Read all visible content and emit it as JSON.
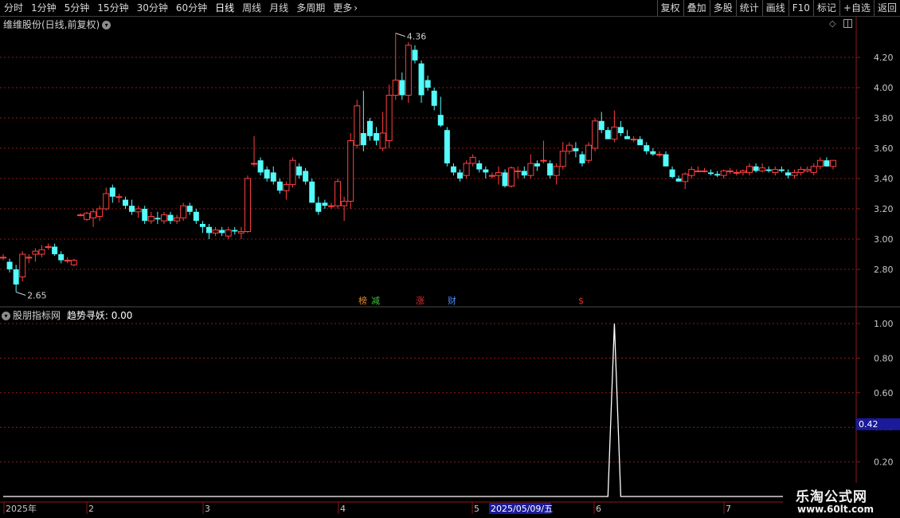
{
  "toolbar": {
    "tabs": [
      "分时",
      "1分钟",
      "5分钟",
      "15分钟",
      "30分钟",
      "60分钟",
      "日线",
      "周线",
      "月线",
      "多周期",
      "更多"
    ],
    "active_tab": "日线",
    "more_chevron": "›",
    "right_buttons": [
      "复权",
      "叠加",
      "多股",
      "统计",
      "画线",
      "F10",
      "标记",
      "+自选",
      "返回"
    ]
  },
  "main_panel": {
    "title": "维维股份(日线,前复权)",
    "collapse_icon": "chevron-down-icon",
    "corner_icons": [
      "diamond-icon",
      "split-icon"
    ],
    "price_axis_labels": [
      "4.20",
      "4.00",
      "3.80",
      "3.60",
      "3.40",
      "3.20",
      "3.00",
      "2.80"
    ],
    "high_label": "4.36",
    "low_label": "2.65",
    "markers": [
      {
        "text": "榜",
        "color": "#e08a3a"
      },
      {
        "text": "减",
        "color": "#38c838"
      },
      {
        "text": "涨",
        "color": "#e03030"
      },
      {
        "text": "财",
        "color": "#4a8aff"
      },
      {
        "text": "$",
        "color": "#e03030"
      }
    ]
  },
  "indicator_panel": {
    "source": "股朋指标网",
    "name": "趋势寻妖",
    "value_label": "0.00",
    "axis_labels": [
      "1.00",
      "0.80",
      "0.60",
      "0.40",
      "0.20"
    ],
    "cursor_value": "0.42"
  },
  "time_axis": {
    "labels": [
      "2025年",
      "2",
      "3",
      "4",
      "5",
      "6",
      "7"
    ],
    "highlight_date": "2025/05/09/五"
  },
  "watermark": {
    "title": "乐淘公式网",
    "url": "www.60lt.com"
  },
  "colors": {
    "up": "#ff4040",
    "down": "#54fcfc",
    "grid": "#8a1a1a",
    "axis_text": "#c8c8c8",
    "cursor_bg": "#1a1a9a"
  },
  "chart_data": [
    {
      "type": "candlestick",
      "title": "维维股份(日线,前复权)",
      "ylim": [
        2.65,
        4.36
      ],
      "y_ticks": [
        2.8,
        3.0,
        3.2,
        3.4,
        3.6,
        3.8,
        4.0,
        4.2
      ],
      "candles": [
        [
          2.88,
          2.9,
          2.86,
          2.88
        ],
        [
          2.85,
          2.87,
          2.78,
          2.8
        ],
        [
          2.8,
          2.83,
          2.65,
          2.7
        ],
        [
          2.75,
          2.92,
          2.72,
          2.9
        ],
        [
          2.88,
          2.9,
          2.84,
          2.88
        ],
        [
          2.9,
          2.94,
          2.85,
          2.92
        ],
        [
          2.9,
          2.96,
          2.88,
          2.93
        ],
        [
          2.95,
          2.97,
          2.93,
          2.95
        ],
        [
          2.95,
          2.97,
          2.89,
          2.9
        ],
        [
          2.9,
          2.92,
          2.84,
          2.86
        ],
        [
          2.86,
          2.88,
          2.84,
          2.86
        ],
        [
          2.83,
          2.87,
          2.82,
          2.86
        ],
        [
          3.16,
          3.17,
          3.15,
          3.16
        ],
        [
          3.13,
          3.18,
          3.12,
          3.17
        ],
        [
          3.14,
          3.2,
          3.08,
          3.18
        ],
        [
          3.15,
          3.22,
          3.12,
          3.2
        ],
        [
          3.2,
          3.34,
          3.19,
          3.3
        ],
        [
          3.34,
          3.36,
          3.24,
          3.28
        ],
        [
          3.28,
          3.3,
          3.24,
          3.28
        ],
        [
          3.26,
          3.28,
          3.2,
          3.22
        ],
        [
          3.22,
          3.26,
          3.16,
          3.18
        ],
        [
          3.18,
          3.22,
          3.14,
          3.2
        ],
        [
          3.2,
          3.22,
          3.1,
          3.12
        ],
        [
          3.12,
          3.18,
          3.1,
          3.15
        ],
        [
          3.14,
          3.18,
          3.1,
          3.13
        ],
        [
          3.12,
          3.18,
          3.1,
          3.16
        ],
        [
          3.16,
          3.18,
          3.1,
          3.12
        ],
        [
          3.12,
          3.16,
          3.1,
          3.14
        ],
        [
          3.14,
          3.24,
          3.12,
          3.22
        ],
        [
          3.22,
          3.24,
          3.16,
          3.18
        ],
        [
          3.18,
          3.2,
          3.1,
          3.12
        ],
        [
          3.1,
          3.12,
          3.04,
          3.08
        ],
        [
          3.08,
          3.1,
          3.0,
          3.04
        ],
        [
          3.04,
          3.08,
          3.02,
          3.06
        ],
        [
          3.06,
          3.08,
          3.02,
          3.04
        ],
        [
          3.02,
          3.08,
          3.0,
          3.06
        ],
        [
          3.06,
          3.08,
          3.03,
          3.05
        ],
        [
          3.04,
          3.08,
          3.0,
          3.05
        ],
        [
          3.05,
          3.42,
          3.04,
          3.4
        ],
        [
          3.5,
          3.68,
          3.48,
          3.5
        ],
        [
          3.52,
          3.54,
          3.42,
          3.44
        ],
        [
          3.46,
          3.48,
          3.38,
          3.4
        ],
        [
          3.44,
          3.48,
          3.36,
          3.38
        ],
        [
          3.38,
          3.4,
          3.3,
          3.32
        ],
        [
          3.32,
          3.38,
          3.26,
          3.36
        ],
        [
          3.36,
          3.54,
          3.34,
          3.52
        ],
        [
          3.48,
          3.5,
          3.4,
          3.42
        ],
        [
          3.45,
          3.47,
          3.36,
          3.38
        ],
        [
          3.38,
          3.4,
          3.24,
          3.24
        ],
        [
          3.24,
          3.28,
          3.16,
          3.18
        ],
        [
          3.24,
          3.26,
          3.2,
          3.22
        ],
        [
          3.22,
          3.24,
          3.2,
          3.22
        ],
        [
          3.22,
          3.4,
          3.2,
          3.38
        ],
        [
          3.22,
          3.28,
          3.12,
          3.25
        ],
        [
          3.25,
          3.7,
          3.2,
          3.65
        ],
        [
          3.62,
          3.92,
          3.6,
          3.88
        ],
        [
          3.7,
          3.98,
          3.58,
          3.62
        ],
        [
          3.78,
          3.8,
          3.65,
          3.68
        ],
        [
          3.7,
          3.74,
          3.62,
          3.65
        ],
        [
          3.6,
          3.84,
          3.58,
          3.7
        ],
        [
          3.65,
          4.02,
          3.6,
          3.95
        ],
        [
          3.95,
          4.36,
          3.92,
          4.05
        ],
        [
          4.05,
          4.1,
          3.92,
          3.95
        ],
        [
          3.95,
          4.3,
          3.9,
          4.28
        ],
        [
          4.25,
          4.28,
          4.16,
          4.18
        ],
        [
          4.16,
          4.18,
          3.9,
          3.95
        ],
        [
          4.05,
          4.08,
          3.98,
          4.0
        ],
        [
          3.98,
          4.0,
          3.85,
          3.88
        ],
        [
          3.82,
          3.94,
          3.74,
          3.75
        ],
        [
          3.72,
          3.74,
          3.48,
          3.5
        ],
        [
          3.48,
          3.5,
          3.42,
          3.44
        ],
        [
          3.44,
          3.46,
          3.38,
          3.4
        ],
        [
          3.42,
          3.52,
          3.4,
          3.5
        ],
        [
          3.5,
          3.56,
          3.48,
          3.54
        ],
        [
          3.5,
          3.52,
          3.44,
          3.46
        ],
        [
          3.46,
          3.48,
          3.4,
          3.44
        ],
        [
          3.42,
          3.44,
          3.4,
          3.42
        ],
        [
          3.42,
          3.48,
          3.36,
          3.44
        ],
        [
          3.44,
          3.46,
          3.34,
          3.35
        ],
        [
          3.35,
          3.48,
          3.34,
          3.47
        ],
        [
          3.45,
          3.48,
          3.4,
          3.45
        ],
        [
          3.45,
          3.48,
          3.4,
          3.42
        ],
        [
          3.42,
          3.56,
          3.4,
          3.5
        ],
        [
          3.5,
          3.52,
          3.45,
          3.48
        ],
        [
          3.52,
          3.65,
          3.5,
          3.52
        ],
        [
          3.5,
          3.52,
          3.4,
          3.42
        ],
        [
          3.42,
          3.5,
          3.36,
          3.48
        ],
        [
          3.48,
          3.64,
          3.46,
          3.58
        ],
        [
          3.58,
          3.64,
          3.56,
          3.62
        ],
        [
          3.6,
          3.64,
          3.54,
          3.58
        ],
        [
          3.56,
          3.58,
          3.48,
          3.5
        ],
        [
          3.52,
          3.64,
          3.5,
          3.62
        ],
        [
          3.6,
          3.8,
          3.58,
          3.78
        ],
        [
          3.78,
          3.84,
          3.7,
          3.72
        ],
        [
          3.72,
          3.74,
          3.66,
          3.66
        ],
        [
          3.66,
          3.85,
          3.64,
          3.74
        ],
        [
          3.74,
          3.78,
          3.68,
          3.7
        ],
        [
          3.68,
          3.72,
          3.66,
          3.66
        ],
        [
          3.66,
          3.68,
          3.64,
          3.66
        ],
        [
          3.66,
          3.68,
          3.62,
          3.62
        ],
        [
          3.62,
          3.64,
          3.56,
          3.58
        ],
        [
          3.58,
          3.6,
          3.55,
          3.56
        ],
        [
          3.56,
          3.58,
          3.54,
          3.56
        ],
        [
          3.56,
          3.58,
          3.48,
          3.48
        ],
        [
          3.46,
          3.48,
          3.4,
          3.41
        ],
        [
          3.4,
          3.42,
          3.38,
          3.38
        ],
        [
          3.38,
          3.44,
          3.33,
          3.43
        ],
        [
          3.42,
          3.48,
          3.4,
          3.46
        ],
        [
          3.45,
          3.48,
          3.44,
          3.45
        ],
        [
          3.45,
          3.47,
          3.44,
          3.45
        ],
        [
          3.44,
          3.46,
          3.42,
          3.43
        ],
        [
          3.43,
          3.45,
          3.41,
          3.42
        ],
        [
          3.42,
          3.46,
          3.4,
          3.45
        ],
        [
          3.45,
          3.47,
          3.43,
          3.45
        ],
        [
          3.44,
          3.46,
          3.42,
          3.44
        ],
        [
          3.44,
          3.46,
          3.42,
          3.45
        ],
        [
          3.44,
          3.5,
          3.42,
          3.48
        ],
        [
          3.48,
          3.5,
          3.44,
          3.45
        ],
        [
          3.45,
          3.5,
          3.44,
          3.47
        ],
        [
          3.46,
          3.48,
          3.44,
          3.45
        ],
        [
          3.44,
          3.48,
          3.42,
          3.46
        ],
        [
          3.46,
          3.48,
          3.44,
          3.45
        ],
        [
          3.44,
          3.46,
          3.4,
          3.42
        ],
        [
          3.42,
          3.46,
          3.4,
          3.44
        ],
        [
          3.44,
          3.48,
          3.42,
          3.46
        ],
        [
          3.45,
          3.48,
          3.44,
          3.46
        ],
        [
          3.44,
          3.5,
          3.42,
          3.48
        ],
        [
          3.48,
          3.54,
          3.46,
          3.52
        ],
        [
          3.52,
          3.54,
          3.48,
          3.48
        ],
        [
          3.48,
          3.52,
          3.46,
          3.52
        ]
      ]
    },
    {
      "type": "line",
      "title": "趋势寻妖",
      "ylim": [
        0,
        1.0
      ],
      "y_ticks": [
        0.2,
        0.4,
        0.6,
        0.8,
        1.0
      ],
      "spike_index": 95,
      "values_nonzero": [
        {
          "index": 95,
          "value": 1.0
        }
      ],
      "n": 125
    }
  ]
}
